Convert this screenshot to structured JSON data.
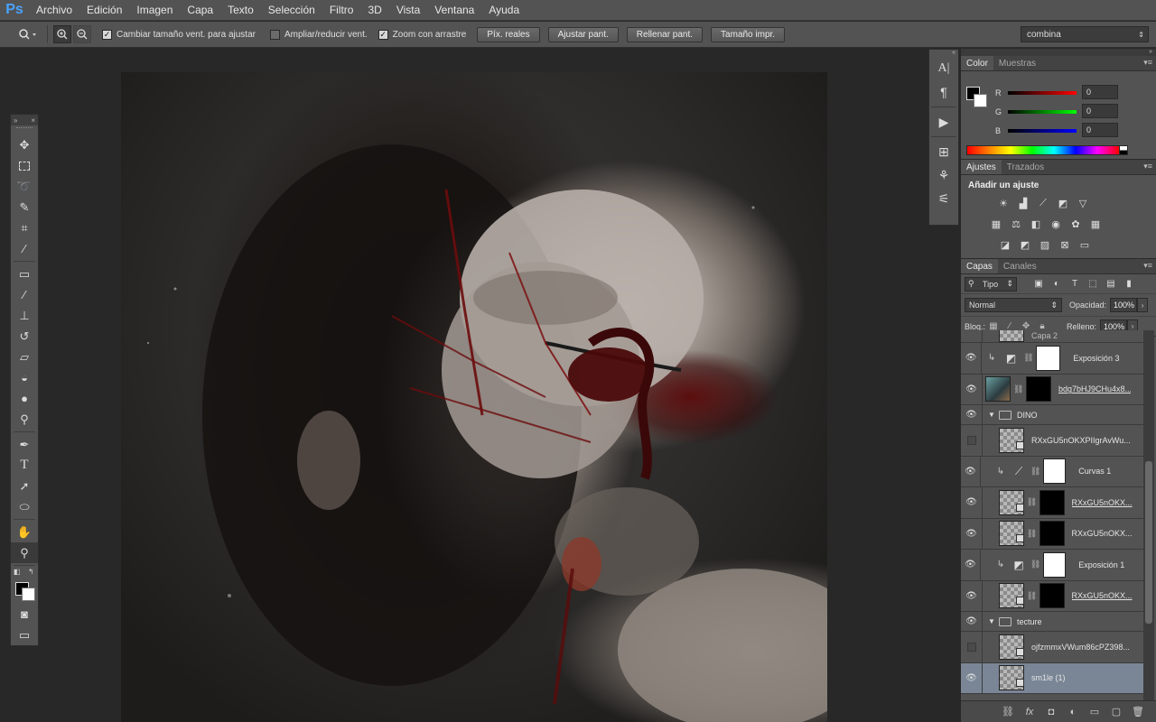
{
  "app": {
    "logo": "Ps"
  },
  "menu": [
    "Archivo",
    "Edición",
    "Imagen",
    "Capa",
    "Texto",
    "Selección",
    "Filtro",
    "3D",
    "Vista",
    "Ventana",
    "Ayuda"
  ],
  "options": {
    "tool_icon": "zoom-icon",
    "cb_resize": {
      "label": "Cambiar tamaño vent. para ajustar",
      "checked": true
    },
    "cb_zoom_all": {
      "label": "Ampliar/reducir vent.",
      "checked": false
    },
    "cb_scrubby": {
      "label": "Zoom con arrastre",
      "checked": true
    },
    "buttons": [
      "Píx. reales",
      "Ajustar pant.",
      "Rellenar pant.",
      "Tamaño impr."
    ],
    "workspace": "combina"
  },
  "color_panel": {
    "tabs": [
      "Color",
      "Muestras"
    ],
    "channels": [
      {
        "label": "R",
        "value": "0",
        "color": "#ff0000"
      },
      {
        "label": "G",
        "value": "0",
        "color": "#00ff00"
      },
      {
        "label": "B",
        "value": "0",
        "color": "#0000ff"
      }
    ]
  },
  "adjust_panel": {
    "tabs": [
      "Ajustes",
      "Trazados"
    ],
    "title": "Añadir un ajuste"
  },
  "layers_panel": {
    "tabs": [
      "Capas",
      "Canales"
    ],
    "kind": "Tipo",
    "blend_mode": "Normal",
    "opacity_label": "Opacidad:",
    "opacity": "100%",
    "lock_label": "Bloq.:",
    "fill_label": "Relleno:",
    "fill": "100%",
    "layers": [
      {
        "name": "Capa 2",
        "type": "partial"
      },
      {
        "name": "Exposición 3",
        "type": "adjustment",
        "visible": true
      },
      {
        "name": "bdg7bHJ9CHu4x8...",
        "type": "photo",
        "visible": true
      },
      {
        "name": "DINO",
        "type": "group",
        "visible": true
      },
      {
        "name": "RXxGU5nOKXPIIgrAvWu...",
        "type": "smart",
        "visible": false
      },
      {
        "name": "Curvas 1",
        "type": "adjustment",
        "visible": true
      },
      {
        "name": "RXxGU5nOKX...",
        "type": "masked",
        "visible": true
      },
      {
        "name": "RXxGU5nOKX...",
        "type": "masked",
        "visible": true
      },
      {
        "name": "Exposición 1",
        "type": "adjustment",
        "visible": true
      },
      {
        "name": "RXxGU5nOKX...",
        "type": "masked",
        "visible": true
      },
      {
        "name": "tecture",
        "type": "group",
        "visible": true
      },
      {
        "name": "ojfzmmxVWum86cPZ398...",
        "type": "smart",
        "visible": false
      },
      {
        "name": "sm1le (1)",
        "type": "smart",
        "visible": true,
        "selected": true
      }
    ]
  }
}
